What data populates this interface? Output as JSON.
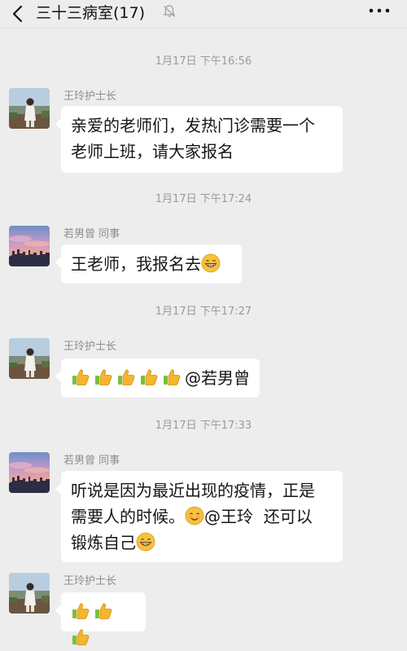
{
  "header": {
    "title": "三十三病室(17)",
    "back_icon": "chevron-left-icon",
    "mute_icon": "bell-off-icon",
    "more_icon": "more-dots-icon"
  },
  "messages": [
    {
      "timestamp": "1月17日 下午16:56",
      "sender": "王玲护士长",
      "avatar": "nurse-photo-avatar",
      "lines": [
        "亲爱的老师们，发热门诊需要一个",
        "老师上班，请大家报名"
      ]
    },
    {
      "timestamp": "1月17日 下午17:24",
      "sender": "若男曾 同事",
      "avatar": "sunset-avatar",
      "lines": [
        "王老师，我报名去"
      ],
      "emoji": "grin-emoji"
    },
    {
      "timestamp": "1月17日 下午17:27",
      "sender": "王玲护士长",
      "avatar": "nurse-photo-avatar",
      "thumbs_count": 5,
      "mention": "@若男曾"
    },
    {
      "timestamp": "1月17日 下午17:33",
      "sender": "若男曾 同事",
      "avatar": "sunset-avatar",
      "line1": "听说是因为最近出现的疫情，正是",
      "line2a": "需要人的时候。",
      "line2b": "@王玲  还可以",
      "line3": "锻炼自己",
      "emojis": [
        "smile-emoji",
        "grin-emoji"
      ]
    },
    {
      "sender": "王玲护士长",
      "avatar": "nurse-photo-avatar",
      "thumbs_count": 3
    }
  ],
  "colors": {
    "background": "#ededed",
    "bubble": "#ffffff",
    "timestamp_text": "#9a9a9a",
    "sender_text": "#8d8d8d",
    "emoji_yellow": "#f7c13b",
    "thumb_yellow": "#f5b52d"
  }
}
